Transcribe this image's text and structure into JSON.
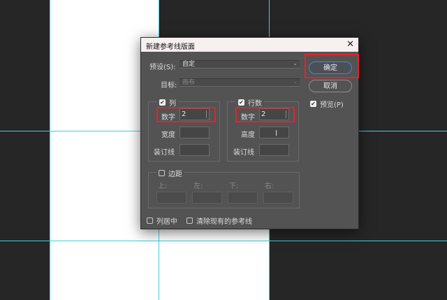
{
  "dialog": {
    "title": "新建参考线版面",
    "preset_label": "预设(S):",
    "preset_value": "自定",
    "target_label": "目标:",
    "target_value": "画布",
    "columns": {
      "label": "列",
      "number_label": "数字",
      "number_value": "2",
      "width_label": "宽度",
      "gutter_label": "装订线"
    },
    "rows": {
      "label": "行数",
      "number_label": "数字",
      "number_value": "2",
      "height_label": "高度",
      "gutter_label": "装订线"
    },
    "margin": {
      "label": "边距",
      "top_label": "上:",
      "left_label": "左:",
      "bottom_label": "下:",
      "right_label": "右:"
    },
    "center_columns_label": "列居中",
    "clear_guides_label": "清除现有的参考线",
    "ok_label": "确定",
    "cancel_label": "取消",
    "preview_label": "预览(P)"
  },
  "colors": {
    "guide": "#3fd0e0",
    "highlight": "#e3242b",
    "primary_button_border": "#5a7dd0"
  },
  "icons": {
    "close": "close-icon",
    "checkbox": "checkmark-icon",
    "dropdown": "chevron-down-icon",
    "cursor": "text-cursor-icon"
  }
}
